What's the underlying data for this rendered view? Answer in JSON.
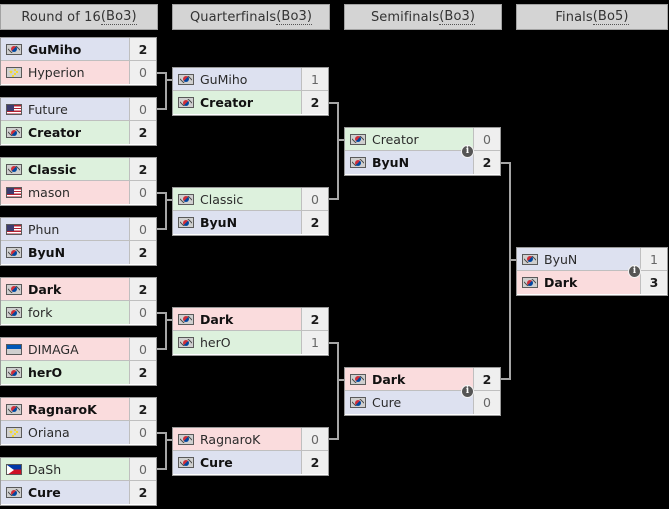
{
  "bracket": {
    "title": "Tournament bracket",
    "rounds": [
      {
        "label_main": "Round of 16 ",
        "label_abbr": "(Bo3)",
        "full": "Round of 16 (Bo3)"
      },
      {
        "label_main": "Quarterfinals ",
        "label_abbr": "(Bo3)",
        "full": "Quarterfinals (Bo3)"
      },
      {
        "label_main": "Semifinals ",
        "label_abbr": "(Bo3)",
        "full": "Semifinals (Bo3)"
      },
      {
        "label_main": "Finals ",
        "label_abbr": "(Bo5)",
        "full": "Finals (Bo5)"
      }
    ],
    "info_badge_label": "i",
    "colors": {
      "background": "#000000",
      "header_bg": "#d4d4d4",
      "header_border": "#a2a2a2",
      "box_border": "#9a9a9a",
      "connector": "#a6a6a6",
      "score_bg": "#efefef",
      "row_blue": "#dde1f0",
      "row_green": "#ddf1dd",
      "row_red": "#fadcdd",
      "badge_bg": "#555555"
    },
    "matches": {
      "r16": [
        {
          "id": "r16-1",
          "teams": [
            {
              "name": "GuMiho",
              "score": "2",
              "flag": "kr",
              "winner": true,
              "tint": "blue"
            },
            {
              "name": "Hyperion",
              "score": "0",
              "flag": "cn",
              "winner": false,
              "tint": "red"
            }
          ]
        },
        {
          "id": "r16-2",
          "teams": [
            {
              "name": "Future",
              "score": "0",
              "flag": "us",
              "winner": false,
              "tint": "blue"
            },
            {
              "name": "Creator",
              "score": "2",
              "flag": "kr",
              "winner": true,
              "tint": "green"
            }
          ]
        },
        {
          "id": "r16-3",
          "teams": [
            {
              "name": "Classic",
              "score": "2",
              "flag": "kr",
              "winner": true,
              "tint": "green"
            },
            {
              "name": "mason",
              "score": "0",
              "flag": "us",
              "winner": false,
              "tint": "red"
            }
          ]
        },
        {
          "id": "r16-4",
          "teams": [
            {
              "name": "Phun",
              "score": "0",
              "flag": "us",
              "winner": false,
              "tint": "blue"
            },
            {
              "name": "ByuN",
              "score": "2",
              "flag": "kr",
              "winner": true,
              "tint": "blue"
            }
          ]
        },
        {
          "id": "r16-5",
          "teams": [
            {
              "name": "Dark",
              "score": "2",
              "flag": "kr",
              "winner": true,
              "tint": "red"
            },
            {
              "name": "fork",
              "score": "0",
              "flag": "kr",
              "winner": false,
              "tint": "green"
            }
          ]
        },
        {
          "id": "r16-6",
          "teams": [
            {
              "name": "DIMAGA",
              "score": "0",
              "flag": "ua",
              "winner": false,
              "tint": "red"
            },
            {
              "name": "herO",
              "score": "2",
              "flag": "kr",
              "winner": true,
              "tint": "green"
            }
          ]
        },
        {
          "id": "r16-7",
          "teams": [
            {
              "name": "RagnaroK",
              "score": "2",
              "flag": "kr",
              "winner": true,
              "tint": "red"
            },
            {
              "name": "Oriana",
              "score": "0",
              "flag": "cn",
              "winner": false,
              "tint": "blue"
            }
          ]
        },
        {
          "id": "r16-8",
          "teams": [
            {
              "name": "DaSh",
              "score": "0",
              "flag": "ph",
              "winner": false,
              "tint": "green"
            },
            {
              "name": "Cure",
              "score": "2",
              "flag": "kr",
              "winner": true,
              "tint": "blue"
            }
          ]
        }
      ],
      "qf": [
        {
          "id": "qf-1",
          "teams": [
            {
              "name": "GuMiho",
              "score": "1",
              "flag": "kr",
              "winner": false,
              "tint": "blue"
            },
            {
              "name": "Creator",
              "score": "2",
              "flag": "kr",
              "winner": true,
              "tint": "green"
            }
          ]
        },
        {
          "id": "qf-2",
          "teams": [
            {
              "name": "Classic",
              "score": "0",
              "flag": "kr",
              "winner": false,
              "tint": "green"
            },
            {
              "name": "ByuN",
              "score": "2",
              "flag": "kr",
              "winner": true,
              "tint": "blue"
            }
          ]
        },
        {
          "id": "qf-3",
          "teams": [
            {
              "name": "Dark",
              "score": "2",
              "flag": "kr",
              "winner": true,
              "tint": "red"
            },
            {
              "name": "herO",
              "score": "1",
              "flag": "kr",
              "winner": false,
              "tint": "green"
            }
          ]
        },
        {
          "id": "qf-4",
          "teams": [
            {
              "name": "RagnaroK",
              "score": "0",
              "flag": "kr",
              "winner": false,
              "tint": "red"
            },
            {
              "name": "Cure",
              "score": "2",
              "flag": "kr",
              "winner": true,
              "tint": "blue"
            }
          ]
        }
      ],
      "sf": [
        {
          "id": "sf-1",
          "has_info": true,
          "teams": [
            {
              "name": "Creator",
              "score": "0",
              "flag": "kr",
              "winner": false,
              "tint": "green"
            },
            {
              "name": "ByuN",
              "score": "2",
              "flag": "kr",
              "winner": true,
              "tint": "blue"
            }
          ]
        },
        {
          "id": "sf-2",
          "has_info": true,
          "teams": [
            {
              "name": "Dark",
              "score": "2",
              "flag": "kr",
              "winner": true,
              "tint": "red"
            },
            {
              "name": "Cure",
              "score": "0",
              "flag": "kr",
              "winner": false,
              "tint": "blue"
            }
          ]
        }
      ],
      "final": [
        {
          "id": "final-1",
          "has_info": true,
          "teams": [
            {
              "name": "ByuN",
              "score": "1",
              "flag": "kr",
              "winner": false,
              "tint": "blue"
            },
            {
              "name": "Dark",
              "score": "3",
              "flag": "kr",
              "winner": true,
              "tint": "red"
            }
          ]
        }
      ]
    }
  }
}
